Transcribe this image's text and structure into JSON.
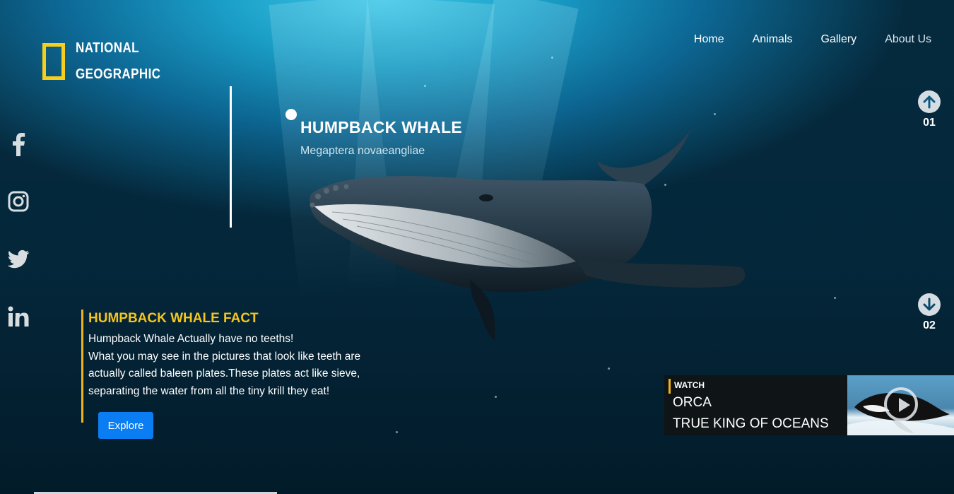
{
  "brand": {
    "line1": "NATIONAL",
    "line2": "GEOGRAPHIC",
    "accent": "#f6cf1c"
  },
  "nav": {
    "items": [
      "Home",
      "Animals",
      "Gallery",
      "About Us"
    ]
  },
  "social": [
    "facebook-icon",
    "instagram-icon",
    "twitter-icon",
    "linkedin-icon"
  ],
  "hero": {
    "title": "HUMPBACK WHALE",
    "subtitle": "Megaptera novaeangliae"
  },
  "pager": {
    "prev": "01",
    "next": "02"
  },
  "fact": {
    "title": "HUMPBACK WHALE FACT",
    "lines": [
      "Humpback Whale Actually have no teeths!",
      "What you may see in the pictures that look like teeth are",
      "actually called baleen plates.These plates act like sieve,",
      "separating the water from all the tiny krill they eat!"
    ],
    "button": "Explore",
    "accent": "#f0b51a",
    "button_color": "#0a7df2"
  },
  "watch": {
    "label": "WATCH",
    "title1": "ORCA",
    "title2": "TRUE KING OF OCEANS"
  }
}
